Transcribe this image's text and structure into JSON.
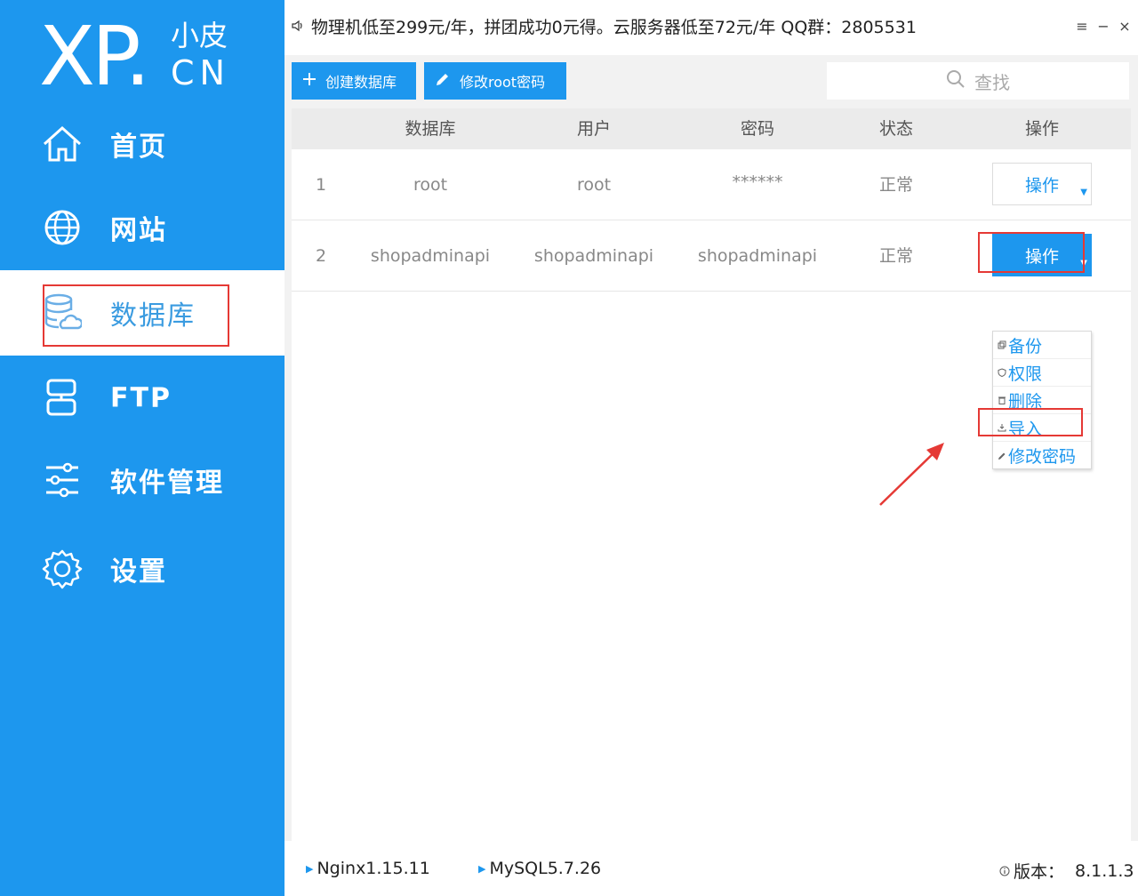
{
  "logo": {
    "main": "XP",
    "top": "小皮",
    "bottom": "CN"
  },
  "sidebar": {
    "items": [
      {
        "label": "首页",
        "icon": "home-icon"
      },
      {
        "label": "网站",
        "icon": "globe-icon"
      },
      {
        "label": "数据库",
        "icon": "database-icon",
        "active": true
      },
      {
        "label": "FTP",
        "icon": "ftp-server-icon"
      },
      {
        "label": "软件管理",
        "icon": "sliders-icon"
      },
      {
        "label": "设置",
        "icon": "gear-icon"
      }
    ]
  },
  "notice": {
    "text": "物理机低至299元/年，拼团成功0元得。云服务器低至72元/年  QQ群：2805531"
  },
  "window_controls": {
    "menu": "≡",
    "minimize": "−",
    "close": "×"
  },
  "toolbar": {
    "create_label": "创建数据库",
    "root_pwd_label": "修改root密码",
    "search_placeholder": "查找"
  },
  "table": {
    "headers": [
      "数据库",
      "用户",
      "密码",
      "状态",
      "操作"
    ],
    "rows": [
      {
        "index": "1",
        "database": "root",
        "user": "root",
        "password": "******",
        "status": "正常",
        "action": "操作"
      },
      {
        "index": "2",
        "database": "shopadminapi",
        "user": "shopadminapi",
        "password": "shopadminapi",
        "status": "正常",
        "action": "操作"
      }
    ]
  },
  "dropdown": {
    "items": [
      "备份",
      "权限",
      "删除",
      "导入",
      "修改密码"
    ]
  },
  "footer": {
    "nginx": "Nginx1.15.11",
    "mysql": "MySQL5.7.26",
    "version_label": "版本：",
    "version": "8.1.1.3"
  },
  "colors": {
    "primary": "#1d97ee",
    "highlight": "#e53935"
  }
}
